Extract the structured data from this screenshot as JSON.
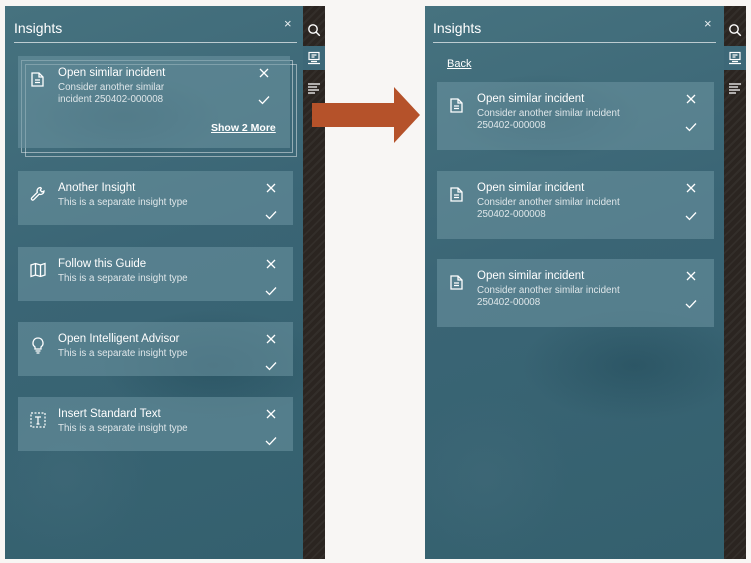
{
  "panels": {
    "left": {
      "title": "Insights",
      "close_glyph": "×",
      "stacked_card": {
        "title": "Open similar incident",
        "description": "Consider another similar incident 250402-000008",
        "icon": "document-icon",
        "show_more": "Show 2 More"
      },
      "cards": [
        {
          "title": "Another Insight",
          "description": "This is a separate insight type",
          "icon": "wrench-icon"
        },
        {
          "title": "Follow this Guide",
          "description": "This is a separate insight type",
          "icon": "map-icon"
        },
        {
          "title": "Open Intelligent Advisor",
          "description": "This is a separate insight type",
          "icon": "lightbulb-icon"
        },
        {
          "title": "Insert Standard Text",
          "description": "This is a separate insight type",
          "icon": "insert-text-icon"
        }
      ]
    },
    "right": {
      "title": "Insights",
      "close_glyph": "×",
      "back_label": "Back",
      "cards": [
        {
          "title": "Open similar incident",
          "description": "Consider another similar incident 250402-000008",
          "icon": "document-icon"
        },
        {
          "title": "Open similar incident",
          "description": "Consider another similar incident 250402-000008",
          "icon": "document-icon"
        },
        {
          "title": "Open similar incident",
          "description": "Consider another similar incident 250402-00008",
          "icon": "document-icon"
        }
      ]
    }
  },
  "rail": {
    "items": [
      "search-icon",
      "insights-icon",
      "list-icon"
    ],
    "active": "insights-icon"
  },
  "colors": {
    "panel_bg": "#3d6878",
    "card_bg": "#6e96a2",
    "rail_bg": "#2b2521",
    "arrow": "#b5522a"
  }
}
